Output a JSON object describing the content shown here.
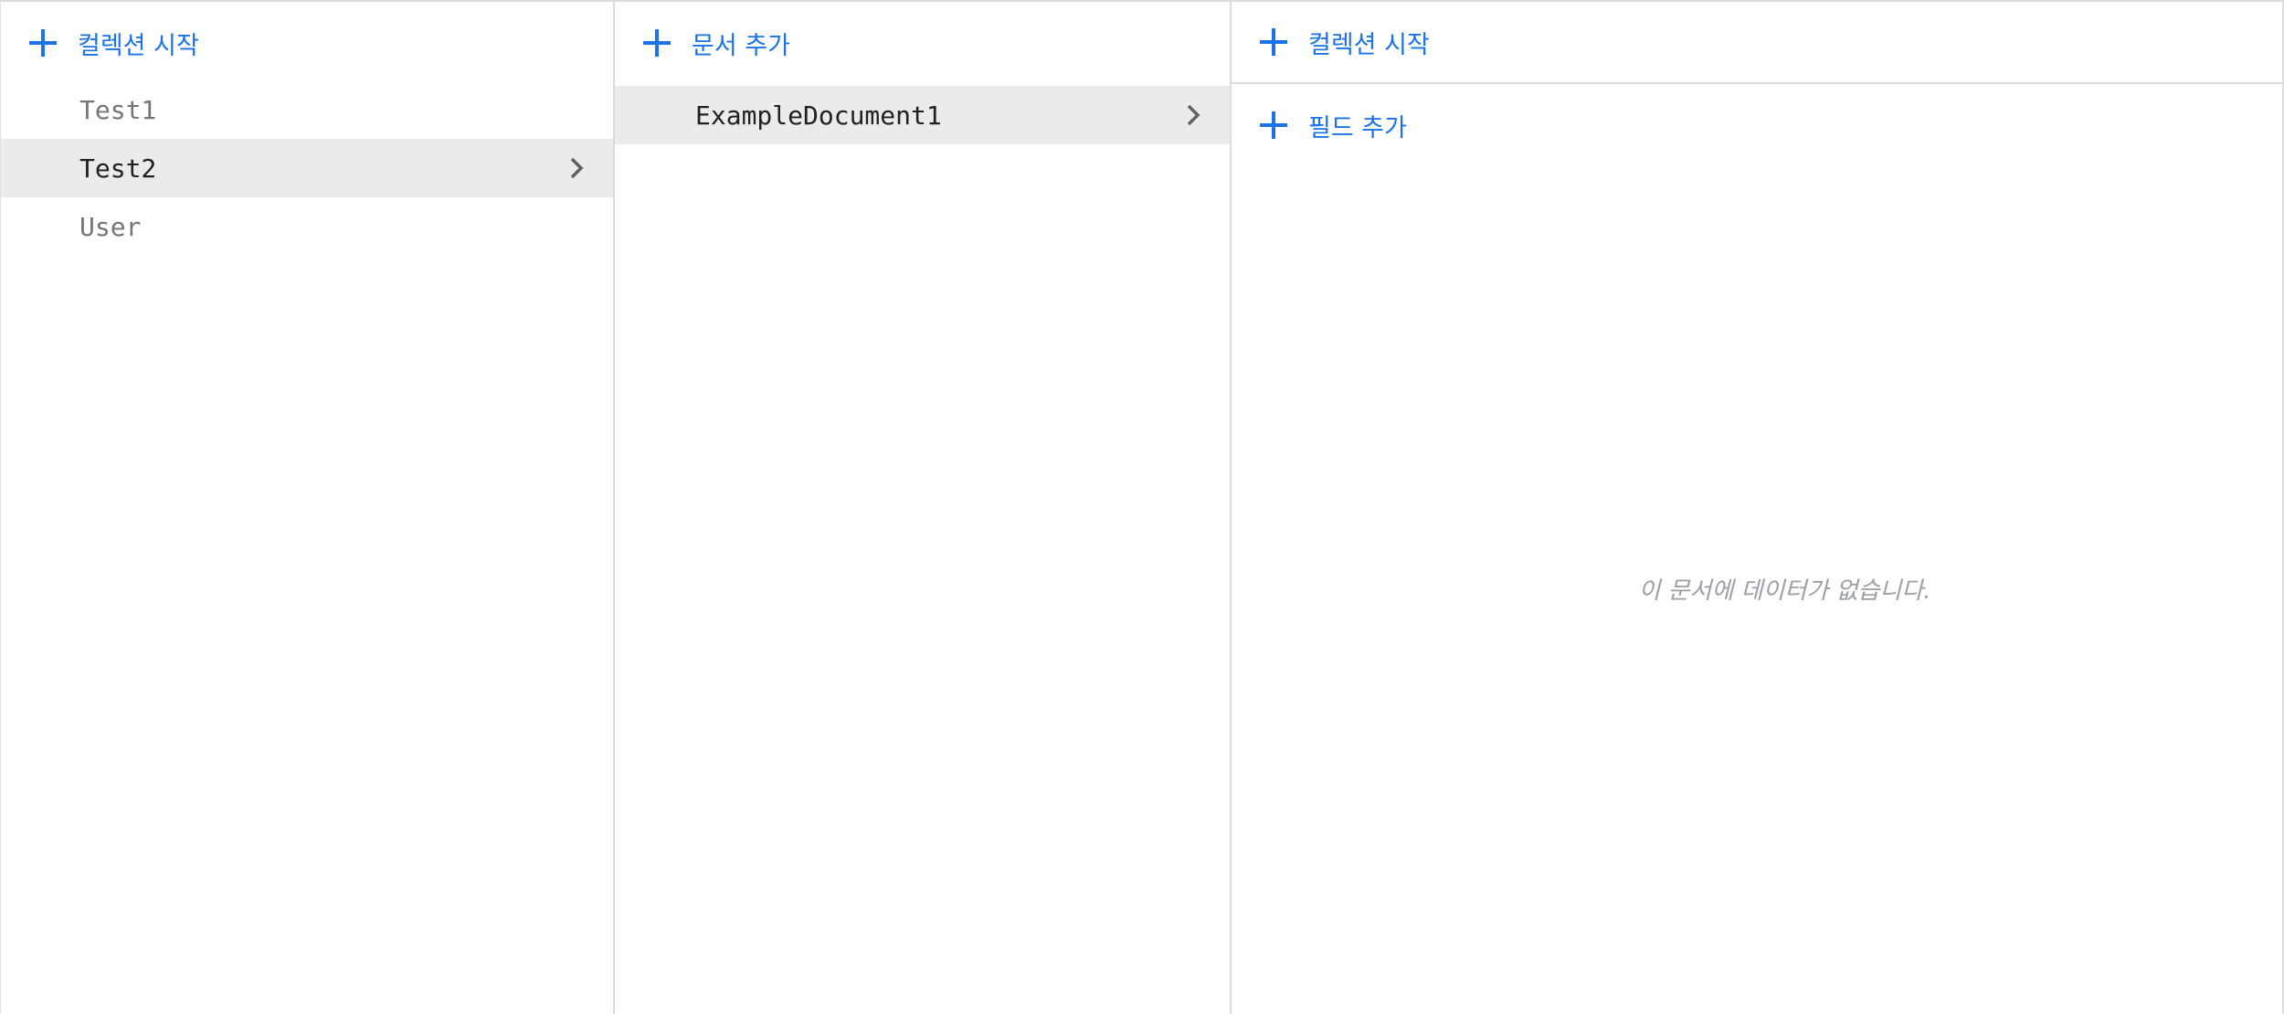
{
  "collections_panel": {
    "start_collection_label": "컬렉션 시작",
    "items": [
      {
        "label": "Test1"
      },
      {
        "label": "Test2"
      },
      {
        "label": "User"
      }
    ]
  },
  "documents_panel": {
    "add_document_label": "문서 추가",
    "items": [
      {
        "label": "ExampleDocument1"
      }
    ]
  },
  "document_panel": {
    "start_collection_label": "컬렉션 시작",
    "add_field_label": "필드 추가",
    "empty_message": "이 문서에 데이터가 없습니다."
  },
  "colors": {
    "accent": "#1a73e8",
    "selected_row": "#ebebeb",
    "divider": "#dadce0",
    "muted_text": "#757575"
  },
  "icons": [
    "plus-icon",
    "chevron-right-icon"
  ]
}
